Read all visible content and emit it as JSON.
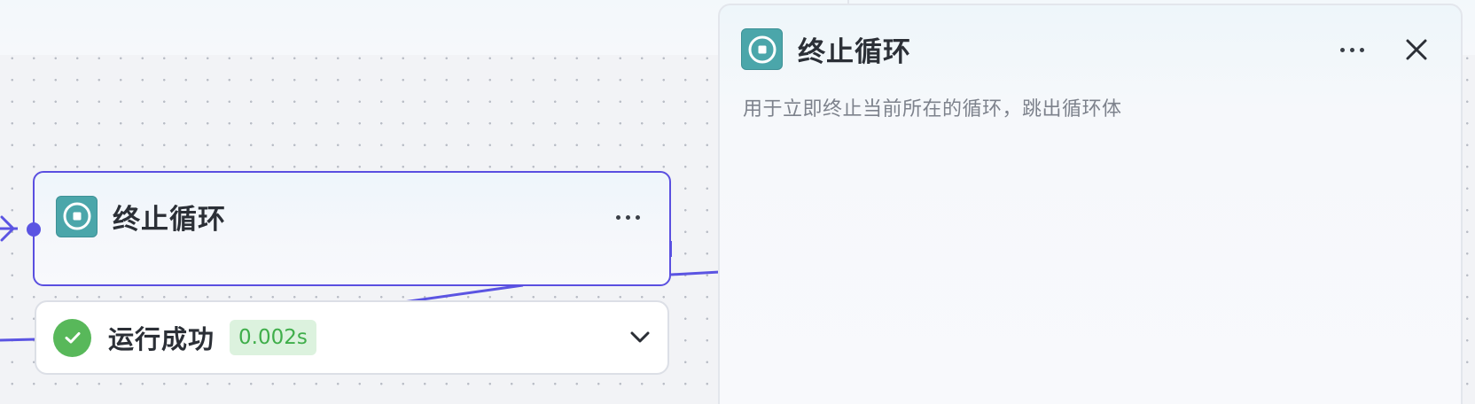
{
  "node": {
    "title": "终止循环",
    "icon": "stop-circle-icon",
    "accent_color": "#5a4fe0",
    "icon_color": "#4ba6aa"
  },
  "run_status": {
    "label": "运行成功",
    "duration": "0.002s",
    "status_color": "#58b85a"
  },
  "panel": {
    "title": "终止循环",
    "description": "用于立即终止当前所在的循环，跳出循环体"
  }
}
